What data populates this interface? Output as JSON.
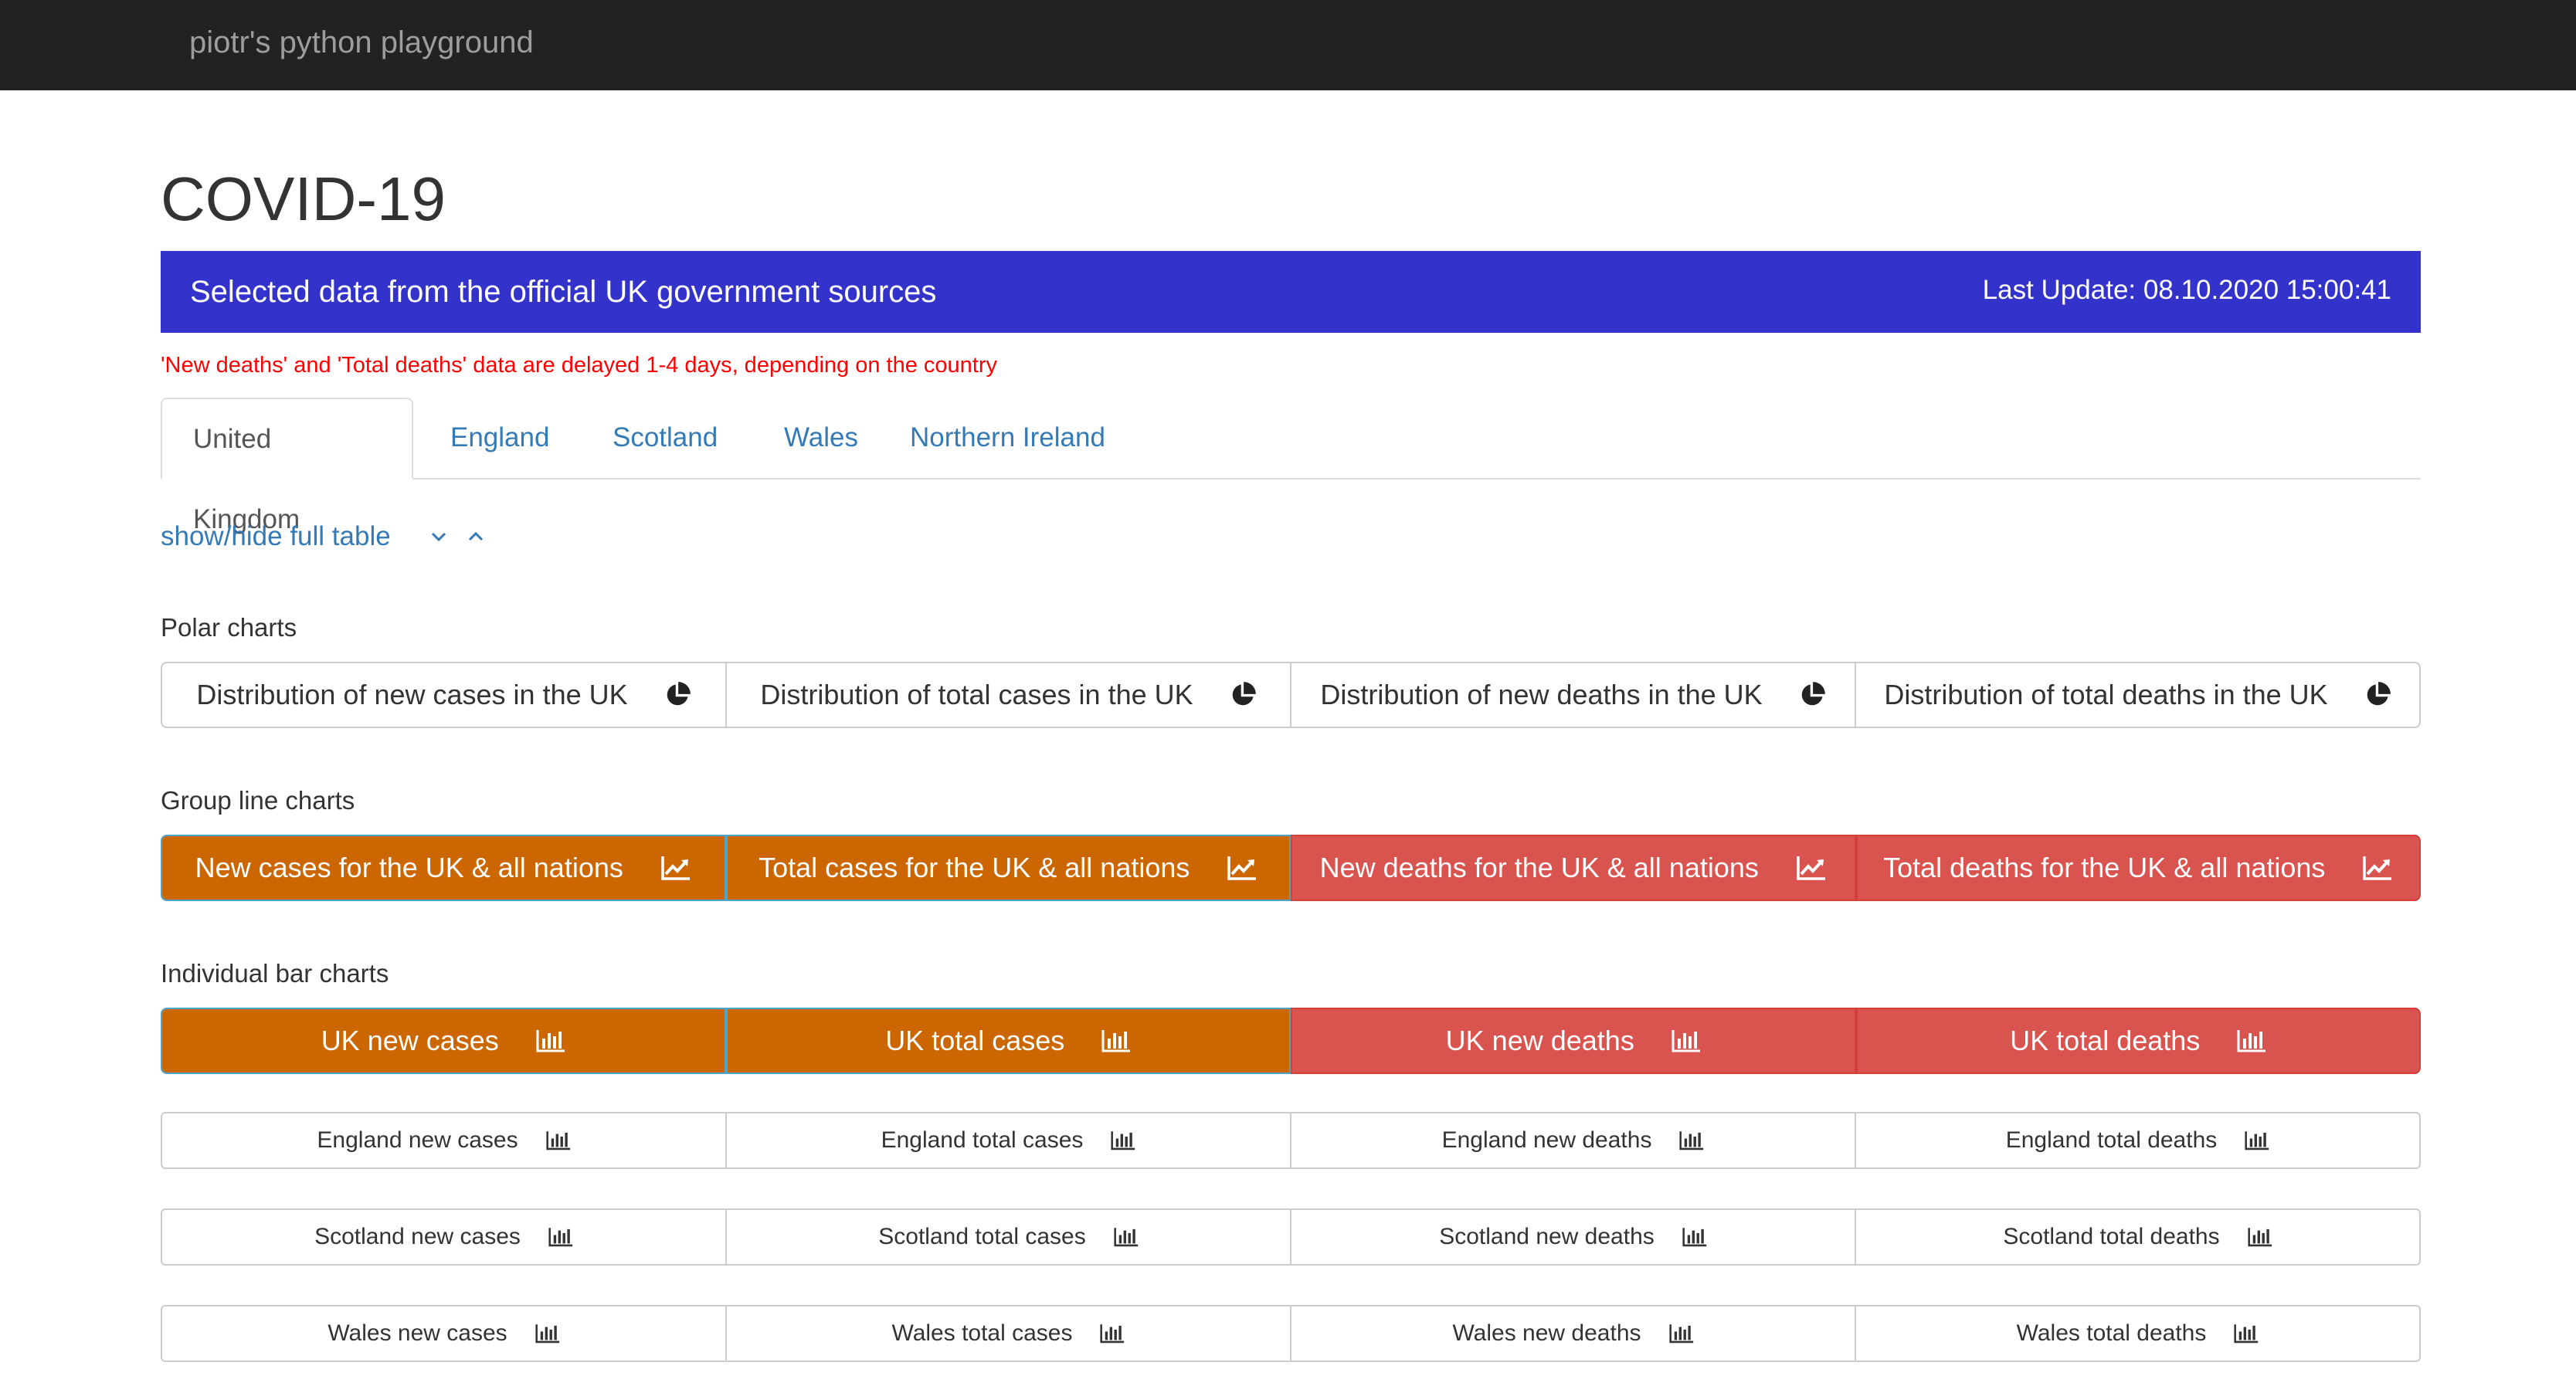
{
  "navbar": {
    "brand": "piotr's python playground"
  },
  "page": {
    "title": "COVID-19"
  },
  "banner": {
    "text": "Selected data from the official UK government sources",
    "last_update": "Last Update: 08.10.2020 15:00:41",
    "color": "#3333cc"
  },
  "note": "'New deaths' and 'Total deaths' data are delayed 1-4 days, depending on the country",
  "tabs": [
    {
      "label": "United Kingdom",
      "active": true
    },
    {
      "label": "England",
      "active": false
    },
    {
      "label": "Scotland",
      "active": false
    },
    {
      "label": "Wales",
      "active": false
    },
    {
      "label": "Northern Ireland",
      "active": false
    }
  ],
  "toggle": {
    "label": "show/hide full table",
    "icons": [
      "chevron-down-icon",
      "chevron-up-icon"
    ]
  },
  "polar": {
    "heading": "Polar charts",
    "buttons": [
      {
        "label": "Distribution of new cases in the UK",
        "icon": "pie-chart-icon"
      },
      {
        "label": "Distribution of total cases in the UK",
        "icon": "pie-chart-icon"
      },
      {
        "label": "Distribution of new deaths in the UK",
        "icon": "pie-chart-icon"
      },
      {
        "label": "Distribution of total deaths in the UK",
        "icon": "pie-chart-icon"
      }
    ]
  },
  "group_line": {
    "heading": "Group line charts",
    "buttons": [
      {
        "label": "New cases for the UK & all nations",
        "icon": "line-chart-icon",
        "color": "#cc6600"
      },
      {
        "label": "Total cases for the UK & all nations",
        "icon": "line-chart-icon",
        "color": "#cc6600"
      },
      {
        "label": "New deaths for the UK & all nations",
        "icon": "line-chart-icon",
        "color": "#d9534f"
      },
      {
        "label": "Total deaths for the UK & all nations",
        "icon": "line-chart-icon",
        "color": "#d9534f"
      }
    ]
  },
  "individual_bar": {
    "heading": "Individual bar charts",
    "main": [
      {
        "label": "UK new cases",
        "icon": "bar-chart-icon",
        "color": "#cc6600"
      },
      {
        "label": "UK total cases",
        "icon": "bar-chart-icon",
        "color": "#cc6600"
      },
      {
        "label": "UK new deaths",
        "icon": "bar-chart-icon",
        "color": "#d9534f"
      },
      {
        "label": "UK total deaths",
        "icon": "bar-chart-icon",
        "color": "#d9534f"
      }
    ],
    "england": [
      "England new cases",
      "England total cases",
      "England new deaths",
      "England total deaths"
    ],
    "scotland": [
      "Scotland new cases",
      "Scotland total cases",
      "Scotland new deaths",
      "Scotland total deaths"
    ],
    "wales": [
      "Wales new cases",
      "Wales total cases",
      "Wales new deaths",
      "Wales total deaths"
    ]
  }
}
